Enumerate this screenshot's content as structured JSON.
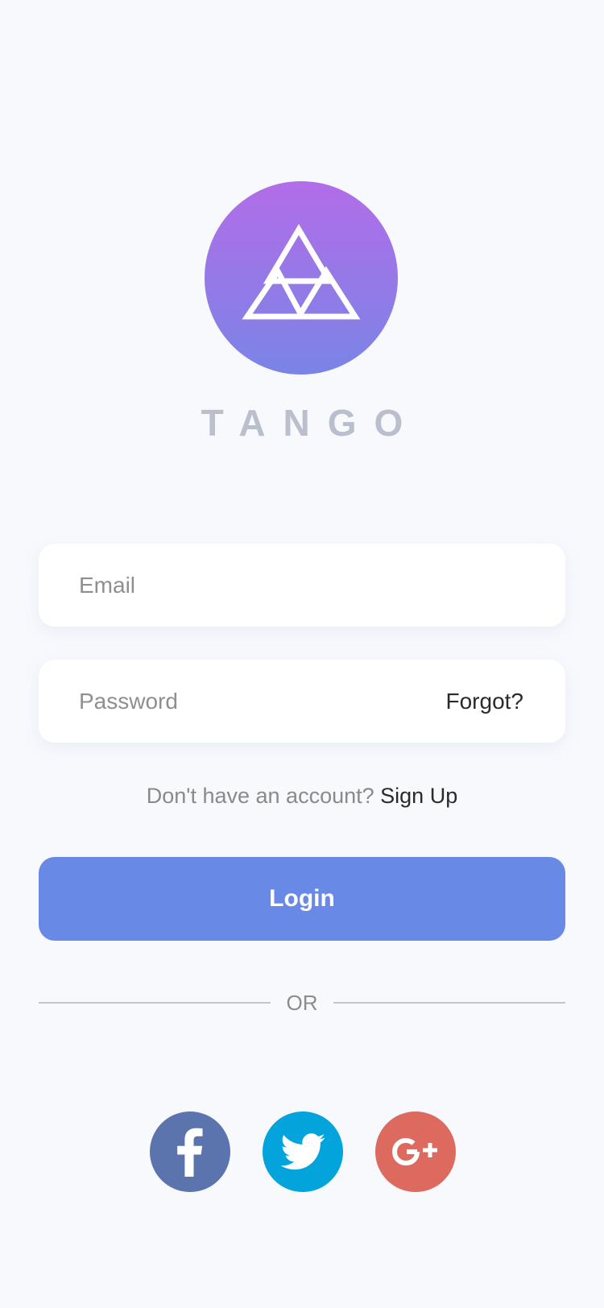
{
  "app": {
    "brand_name": "TANGO",
    "logo_icon": "triangle-logo-icon"
  },
  "form": {
    "email": {
      "placeholder": "Email",
      "value": ""
    },
    "password": {
      "placeholder": "Password",
      "value": "",
      "forgot_label": "Forgot?"
    },
    "signup_prompt": "Don't have an account?",
    "signup_link": "Sign Up",
    "login_label": "Login",
    "divider_label": "OR"
  },
  "social": [
    {
      "name": "facebook",
      "icon": "facebook-icon",
      "color": "#5b74ad"
    },
    {
      "name": "twitter",
      "icon": "twitter-icon",
      "color": "#03a3dc"
    },
    {
      "name": "google-plus",
      "icon": "google-plus-icon",
      "color": "#dd6a5e"
    }
  ],
  "colors": {
    "background": "#f7f9fd",
    "accent": "#6889e6",
    "logo_gradient_top": "#b26de8",
    "logo_gradient_bottom": "#7a84e6",
    "brand_text": "#b9bfcc"
  }
}
